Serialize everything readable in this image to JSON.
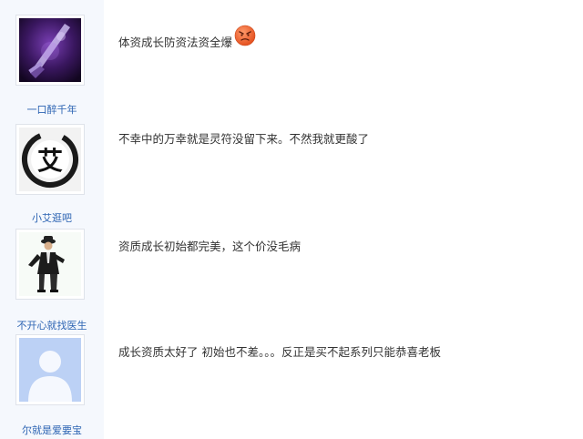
{
  "posts": [
    {
      "username": "一口醉千年",
      "content": "体资成长防资法资全爆",
      "avatar_icon": "purple-sword-avatar-icon",
      "emoji_icon": "angry-face-emoji-icon"
    },
    {
      "username": "小艾逛吧",
      "content": "不幸中的万幸就是灵符没留下来。不然我就更酸了",
      "avatar_icon": "ink-calligraphy-ai-avatar-icon",
      "avatar_glyph": "艾"
    },
    {
      "username": "不开心就找医生",
      "content": "资质成长初始都完美，这个价没毛病",
      "avatar_icon": "hat-man-avatar-icon"
    },
    {
      "username": "尔就是爱要宝",
      "content": "成长资质太好了 初始也不差。。。反正是买不起系列只能恭喜老板",
      "avatar_icon": "default-user-avatar-icon"
    }
  ],
  "colors": {
    "username": "#2d64b3",
    "text": "#333333",
    "sidebar_bg": "#f5f8fd"
  }
}
